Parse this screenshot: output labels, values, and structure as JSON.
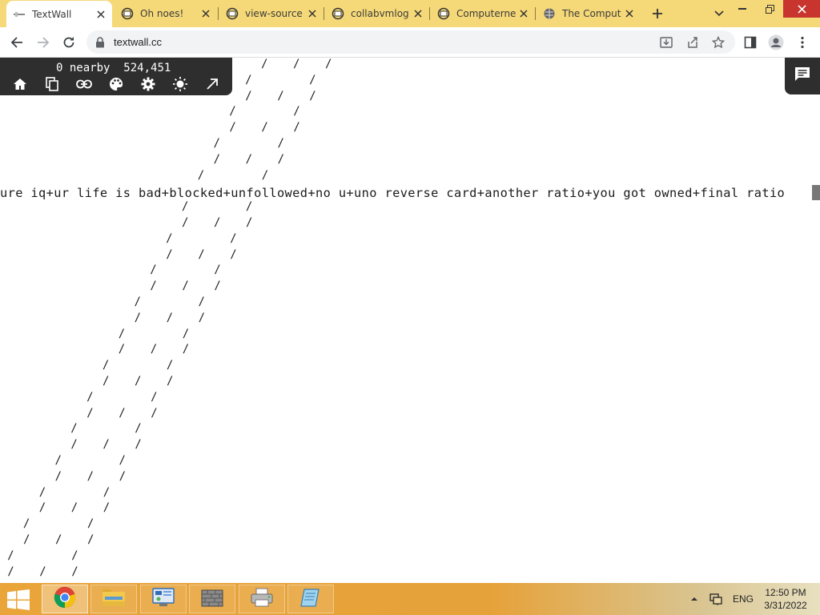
{
  "browser": {
    "tabs": [
      {
        "title": "TextWall",
        "active": true,
        "favicon": "textwall-favicon"
      },
      {
        "title": "Oh noes!",
        "active": false,
        "favicon": "collabvm-favicon"
      },
      {
        "title": "view-source",
        "active": false,
        "favicon": "collabvm-favicon"
      },
      {
        "title": "collabvmlog",
        "active": false,
        "favicon": "collabvm-favicon"
      },
      {
        "title": "Computerne",
        "active": false,
        "favicon": "collabvm-favicon"
      },
      {
        "title": "The Comput",
        "active": false,
        "favicon": "globe-icon"
      }
    ],
    "url": "textwall.cc"
  },
  "textwall": {
    "nearby_label": "0 nearby",
    "coordinates": "524,451",
    "chat_line": "ure iq+ur life is bad+blocked+unfollowed+no u+uno reverse card+another ratio+you got owned+final ratio",
    "slash_glyph": "/"
  },
  "taskbar": {
    "language": "ENG",
    "time": "12:50 PM",
    "date": "3/31/2022",
    "apps": [
      "chrome-icon",
      "file-explorer-icon",
      "control-panel-icon",
      "firewall-icon",
      "printer-icon",
      "notepad-icon"
    ]
  },
  "colors": {
    "tabstrip": "#f5d877",
    "hud_bg": "#2e2e2e",
    "taskbar": "#e9a43a"
  }
}
